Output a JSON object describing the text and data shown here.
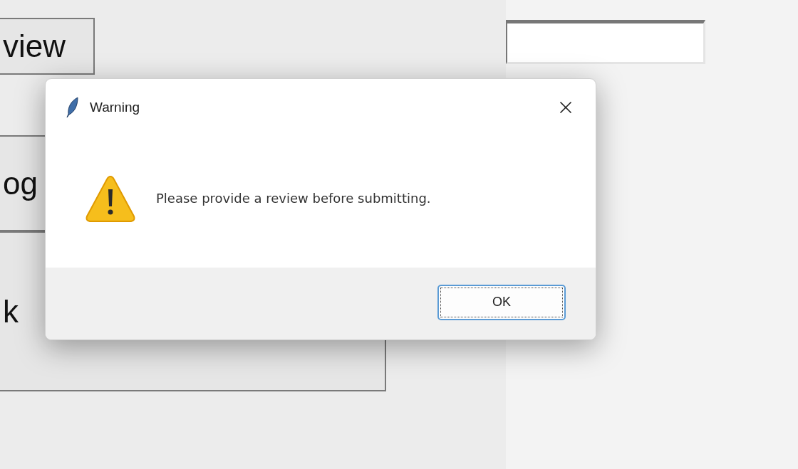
{
  "background_window": {
    "buttons": [
      {
        "label": "view"
      },
      {
        "label": "og"
      },
      {
        "label": "k"
      }
    ]
  },
  "dialog": {
    "title": "Warning",
    "message": "Please provide a review before submitting.",
    "buttons": [
      {
        "label": "OK",
        "focused": true
      }
    ]
  }
}
